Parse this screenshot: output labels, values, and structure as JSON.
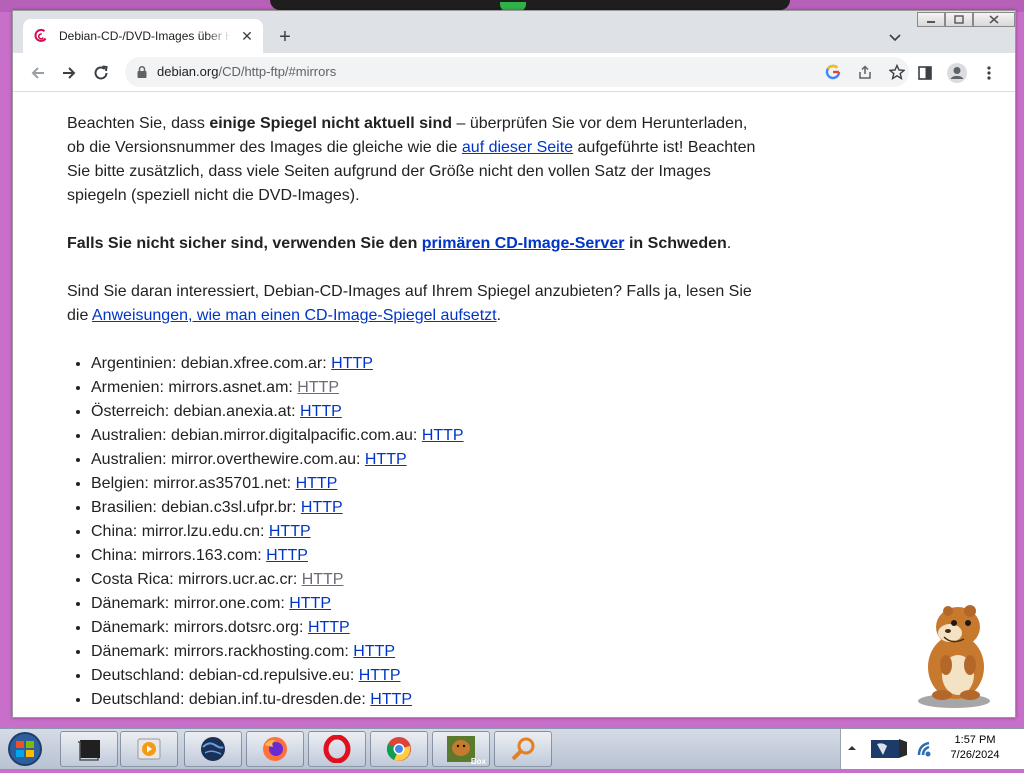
{
  "browser": {
    "tab_title": "Debian-CD-/DVD-Images über HTTP/FTP",
    "url_host": "debian.org",
    "url_path": "/CD/http-ftp/#mirrors"
  },
  "content": {
    "p1_a": "Beachten Sie, dass ",
    "p1_bold": "einige Spiegel nicht aktuell sind",
    "p1_b": " – überprüfen Sie vor dem Herunterladen, ob die Versionsnummer des Images die gleiche wie die ",
    "p1_link": "auf dieser Seite",
    "p1_c": " aufgeführte ist! Beachten Sie bitte zusätzlich, dass viele Seiten aufgrund der Größe nicht den vollen Satz der Images spiegeln (speziell nicht die DVD-Images).",
    "p2_a": "Falls Sie nicht sicher sind, verwenden Sie den ",
    "p2_link": "primären CD-Image-Server",
    "p2_b": " in Schweden",
    "p2_c": ".",
    "p3_a": "Sind Sie daran interessiert, Debian-CD-Images auf Ihrem Spiegel anzubieten? Falls ja, lesen Sie die ",
    "p3_link": "Anweisungen, wie man einen CD-Image-Spiegel aufsetzt",
    "p3_b": ".",
    "mirrors": [
      {
        "text": "Argentinien: debian.xfree.com.ar: ",
        "link": "HTTP"
      },
      {
        "text": "Armenien: mirrors.asnet.am: ",
        "link": "HTTP"
      },
      {
        "text": "Österreich: debian.anexia.at: ",
        "link": "HTTP"
      },
      {
        "text": "Australien: debian.mirror.digitalpacific.com.au: ",
        "link": "HTTP"
      },
      {
        "text": "Australien: mirror.overthewire.com.au: ",
        "link": "HTTP"
      },
      {
        "text": "Belgien: mirror.as35701.net: ",
        "link": "HTTP"
      },
      {
        "text": "Brasilien: debian.c3sl.ufpr.br: ",
        "link": "HTTP"
      },
      {
        "text": "China: mirror.lzu.edu.cn: ",
        "link": "HTTP"
      },
      {
        "text": "China: mirrors.163.com: ",
        "link": "HTTP"
      },
      {
        "text": "Costa Rica: mirrors.ucr.ac.cr: ",
        "link": "HTTP"
      },
      {
        "text": "Dänemark: mirror.one.com: ",
        "link": "HTTP"
      },
      {
        "text": "Dänemark: mirrors.dotsrc.org: ",
        "link": "HTTP"
      },
      {
        "text": "Dänemark: mirrors.rackhosting.com: ",
        "link": "HTTP"
      },
      {
        "text": "Deutschland: debian-cd.repulsive.eu: ",
        "link": "HTTP"
      },
      {
        "text": "Deutschland: debian.inf.tu-dresden.de: ",
        "link": "HTTP"
      }
    ]
  },
  "taskbar": {
    "time": "1:57 PM",
    "date": "7/26/2024",
    "box_label": "Box"
  },
  "colors": {
    "desktop": "#c86fc9",
    "link": "#0035c7",
    "visited_link": "#6b6b7a",
    "debian_red": "#d70a53"
  }
}
